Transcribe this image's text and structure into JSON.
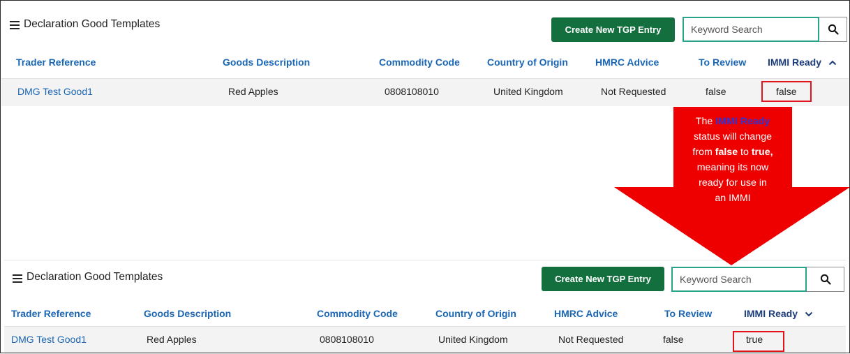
{
  "panels": [
    {
      "title": "Declaration Good Templates",
      "create_label": "Create New TGP Entry",
      "search_placeholder": "Keyword Search",
      "columns": [
        "Trader Reference",
        "Goods Description",
        "Commodity Code",
        "Country of Origin",
        "HMRC Advice",
        "To Review",
        "IMMI Ready"
      ],
      "sort_direction": "ascending",
      "row": {
        "trader_reference": "DMG Test Good1",
        "goods_description": "Red Apples",
        "commodity_code": "0808108010",
        "country_of_origin": "United Kingdom",
        "hmrc_advice": "Not Requested",
        "to_review": "false",
        "immi_ready": "false"
      }
    },
    {
      "title": "Declaration Good Templates",
      "create_label": "Create New TGP Entry",
      "search_placeholder": "Keyword Search",
      "columns": [
        "Trader Reference",
        "Goods Description",
        "Commodity Code",
        "Country of Origin",
        "HMRC Advice",
        "To Review",
        "IMMI Ready"
      ],
      "sort_direction": "descending",
      "row": {
        "trader_reference": "DMG Test Good1",
        "goods_description": "Red Apples",
        "commodity_code": "0808108010",
        "country_of_origin": "United Kingdom",
        "hmrc_advice": "Not Requested",
        "to_review": "false",
        "immi_ready": "true"
      }
    }
  ],
  "callout": {
    "text_1": "The ",
    "highlight": "IMMI Ready",
    "text_2": "status will change",
    "text_3": "from ",
    "from_value": "false",
    "text_4": " to ",
    "to_value": "true,",
    "text_5": "meaning its now",
    "text_6": "ready for use in",
    "text_7": "an IMMI"
  },
  "colors": {
    "primary_button": "#146f3f",
    "link": "#1a66b3",
    "callout": "#ee0000",
    "highlight_border": "#e0141a",
    "search_border": "#2aa38a"
  }
}
